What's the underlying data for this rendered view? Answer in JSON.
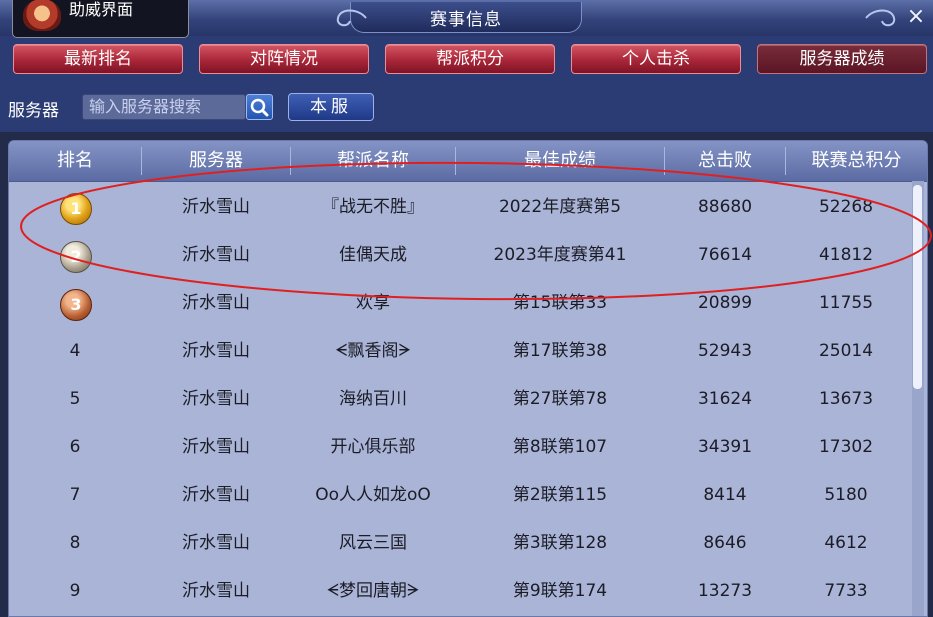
{
  "window": {
    "title": "赛事信息",
    "close_icon": "×"
  },
  "tooltip": {
    "text": "助威界面",
    "icon": "mascot-icon"
  },
  "tabs": [
    {
      "label": "最新排名",
      "active": false
    },
    {
      "label": "对阵情况",
      "active": false
    },
    {
      "label": "帮派积分",
      "active": false
    },
    {
      "label": "个人击杀",
      "active": false
    },
    {
      "label": "服务器成绩",
      "active": true
    }
  ],
  "search": {
    "label": "服务器",
    "placeholder": "输入服务器搜索",
    "search_icon": "search-icon",
    "local_button": "本服"
  },
  "table": {
    "headers": [
      "排名",
      "服务器",
      "帮派名称",
      "最佳成绩",
      "总击败",
      "联赛总积分"
    ],
    "rows": [
      {
        "rank": "1",
        "medal": "gold",
        "server": "沂水雪山",
        "guild": "『战无不胜』",
        "best": "2022年度赛第5",
        "kills": "88680",
        "points": "52268"
      },
      {
        "rank": "2",
        "medal": "silver",
        "server": "沂水雪山",
        "guild": "佳偶天成",
        "best": "2023年度赛第41",
        "kills": "76614",
        "points": "41812"
      },
      {
        "rank": "3",
        "medal": "bronze",
        "server": "沂水雪山",
        "guild": "欢享",
        "best": "第15联第33",
        "kills": "20899",
        "points": "11755"
      },
      {
        "rank": "4",
        "medal": "",
        "server": "沂水雪山",
        "guild": "ᗕ飘香阁ᗒ",
        "best": "第17联第38",
        "kills": "52943",
        "points": "25014"
      },
      {
        "rank": "5",
        "medal": "",
        "server": "沂水雪山",
        "guild": "海纳百川",
        "best": "第27联第78",
        "kills": "31624",
        "points": "13673"
      },
      {
        "rank": "6",
        "medal": "",
        "server": "沂水雪山",
        "guild": "开心俱乐部",
        "best": "第8联第107",
        "kills": "34391",
        "points": "17302"
      },
      {
        "rank": "7",
        "medal": "",
        "server": "沂水雪山",
        "guild": "Oo人人如龙oO",
        "best": "第2联第115",
        "kills": "8414",
        "points": "5180"
      },
      {
        "rank": "8",
        "medal": "",
        "server": "沂水雪山",
        "guild": "风云三国",
        "best": "第3联第128",
        "kills": "8646",
        "points": "4612"
      },
      {
        "rank": "9",
        "medal": "",
        "server": "沂水雪山",
        "guild": "ᗕ梦回唐朝ᗒ",
        "best": "第9联第174",
        "kills": "13273",
        "points": "7733"
      }
    ]
  },
  "colors": {
    "annotation": "#e02020",
    "header_bg": "#5b6ba3",
    "row_bg": "#a9b4d6"
  }
}
